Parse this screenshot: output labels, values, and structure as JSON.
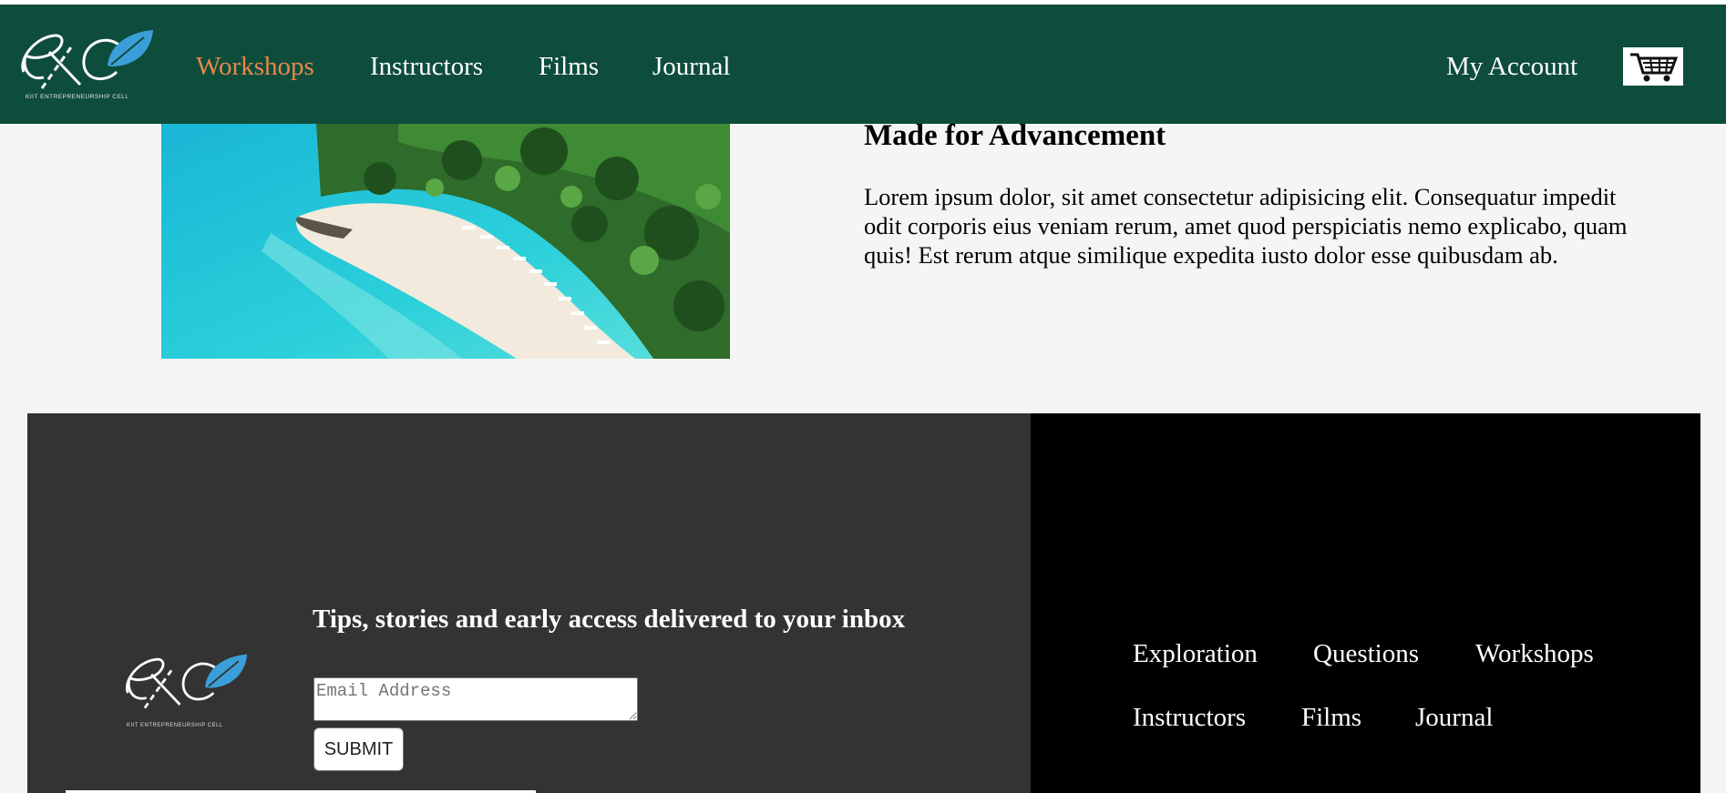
{
  "header": {
    "logo_caption": "KIIT ENTREPRENEURSHIP CELL",
    "nav": [
      {
        "label": "Workshops",
        "active": true
      },
      {
        "label": "Instructors",
        "active": false
      },
      {
        "label": "Films",
        "active": false
      },
      {
        "label": "Journal",
        "active": false
      }
    ],
    "account_label": "My Account",
    "cart_icon": "cart-icon",
    "active_color": "#e8884a",
    "bg_color": "#0e4d3c"
  },
  "feature": {
    "image_subject": "tropical-beach-aerial",
    "title": "Made for Advancement",
    "text": "Lorem ipsum dolor, sit amet consectetur adipisicing elit. Consequatur impedit odit corporis eius veniam rerum, amet quod perspiciatis nemo explicabo, quam quis! Est rerum atque similique expedita iusto dolor esse quibusdam ab."
  },
  "footer": {
    "logo_caption": "KIIT ENTREPRENEURSHIP CELL",
    "newsletter_title": "Tips, stories and early access delivered to your inbox",
    "email_placeholder": "Email Address",
    "submit_label": "SUBMIT",
    "links": [
      {
        "label": "Exploration"
      },
      {
        "label": "Questions"
      },
      {
        "label": "Workshops"
      },
      {
        "label": "Instructors"
      },
      {
        "label": "Films"
      },
      {
        "label": "Journal"
      }
    ]
  }
}
